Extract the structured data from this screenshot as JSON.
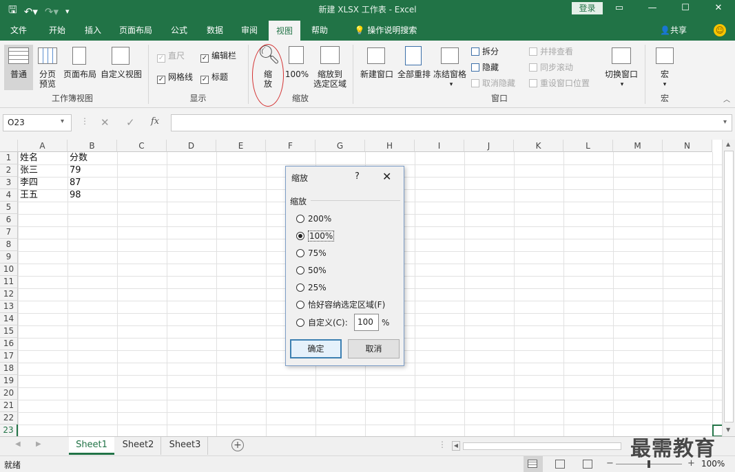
{
  "window": {
    "title": "新建 XLSX 工作表  -  Excel",
    "login": "登录"
  },
  "tabs": [
    "文件",
    "开始",
    "插入",
    "页面布局",
    "公式",
    "数据",
    "审阅",
    "视图",
    "帮助"
  ],
  "tell_me": "操作说明搜索",
  "share": "共享",
  "ribbon": {
    "normal": "普通",
    "page_break_1": "分页",
    "page_break_2": "预览",
    "page_layout": "页面布局",
    "custom_view": "自定义视图",
    "group_views": "工作簿视图",
    "ruler": "直尺",
    "formula_bar": "编辑栏",
    "gridlines": "网格线",
    "headings": "标题",
    "group_show": "显示",
    "zoom_1": "缩",
    "zoom_2": "放",
    "zoom_100": "100%",
    "zoom_sel_1": "缩放到",
    "zoom_sel_2": "选定区域",
    "group_zoom": "缩放",
    "new_window": "新建窗口",
    "arrange_all": "全部重排",
    "freeze": "冻结窗格",
    "split": "拆分",
    "hide": "隐藏",
    "unhide": "取消隐藏",
    "side_by_side": "并排查看",
    "sync_scroll": "同步滚动",
    "reset_pos": "重设窗口位置",
    "switch_windows": "切换窗口",
    "group_window": "窗口",
    "macros": "宏",
    "group_macros": "宏"
  },
  "namebox": "O23",
  "fx": "fx",
  "columns": [
    "A",
    "B",
    "C",
    "D",
    "E",
    "F",
    "G",
    "H",
    "I",
    "J",
    "K",
    "L",
    "M",
    "N"
  ],
  "rows": [
    "1",
    "2",
    "3",
    "4",
    "5",
    "6",
    "7",
    "8",
    "9",
    "10",
    "11",
    "12",
    "13",
    "14",
    "15",
    "16",
    "17",
    "18",
    "19",
    "20",
    "21",
    "22",
    "23"
  ],
  "cells": [
    {
      "a": "姓名",
      "b": "分数"
    },
    {
      "a": "张三",
      "b": "79"
    },
    {
      "a": "李四",
      "b": "87"
    },
    {
      "a": "王五",
      "b": "98"
    }
  ],
  "sheets": [
    "Sheet1",
    "Sheet2",
    "Sheet3"
  ],
  "status": {
    "ready": "就绪",
    "zoom": "100%"
  },
  "dialog": {
    "title": "缩放",
    "help": "?",
    "section": "缩放",
    "options": [
      "200%",
      "100%",
      "75%",
      "50%",
      "25%",
      "恰好容纳选定区域(F)",
      "自定义(C):"
    ],
    "selected": "100%",
    "custom_value": "100",
    "percent": "%",
    "ok": "确定",
    "cancel": "取消"
  },
  "watermark": "最需教育",
  "colors": {
    "accent": "#217346",
    "annotation": "#d32f2f"
  }
}
